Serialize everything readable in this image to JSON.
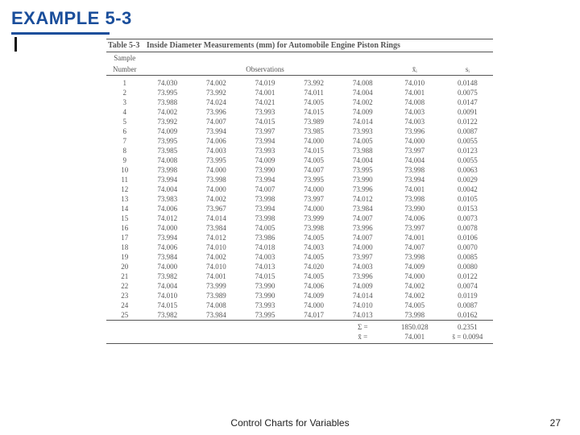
{
  "title": "EXAMPLE 5-3",
  "footer": "Control Charts for Variables",
  "page_number": "27",
  "table": {
    "number": "Table 5-3",
    "title": "Inside Diameter Measurements (mm) for Automobile Engine Piston Rings",
    "headers": {
      "sample1": "Sample",
      "sample2": "Number",
      "observations": "Observations",
      "xbar": "x̄ᵢ",
      "si": "sᵢ"
    },
    "rows": [
      {
        "n": "1",
        "o": [
          "74.030",
          "74.002",
          "74.019",
          "73.992",
          "74.008"
        ],
        "x": "74.010",
        "s": "0.0148"
      },
      {
        "n": "2",
        "o": [
          "73.995",
          "73.992",
          "74.001",
          "74.011",
          "74.004"
        ],
        "x": "74.001",
        "s": "0.0075"
      },
      {
        "n": "3",
        "o": [
          "73.988",
          "74.024",
          "74.021",
          "74.005",
          "74.002"
        ],
        "x": "74.008",
        "s": "0.0147"
      },
      {
        "n": "4",
        "o": [
          "74.002",
          "73.996",
          "73.993",
          "74.015",
          "74.009"
        ],
        "x": "74.003",
        "s": "0.0091"
      },
      {
        "n": "5",
        "o": [
          "73.992",
          "74.007",
          "74.015",
          "73.989",
          "74.014"
        ],
        "x": "74.003",
        "s": "0.0122"
      },
      {
        "n": "6",
        "o": [
          "74.009",
          "73.994",
          "73.997",
          "73.985",
          "73.993"
        ],
        "x": "73.996",
        "s": "0.0087"
      },
      {
        "n": "7",
        "o": [
          "73.995",
          "74.006",
          "73.994",
          "74.000",
          "74.005"
        ],
        "x": "74.000",
        "s": "0.0055"
      },
      {
        "n": "8",
        "o": [
          "73.985",
          "74.003",
          "73.993",
          "74.015",
          "73.988"
        ],
        "x": "73.997",
        "s": "0.0123"
      },
      {
        "n": "9",
        "o": [
          "74.008",
          "73.995",
          "74.009",
          "74.005",
          "74.004"
        ],
        "x": "74.004",
        "s": "0.0055"
      },
      {
        "n": "10",
        "o": [
          "73.998",
          "74.000",
          "73.990",
          "74.007",
          "73.995"
        ],
        "x": "73.998",
        "s": "0.0063"
      },
      {
        "n": "11",
        "o": [
          "73.994",
          "73.998",
          "73.994",
          "73.995",
          "73.990"
        ],
        "x": "73.994",
        "s": "0.0029"
      },
      {
        "n": "12",
        "o": [
          "74.004",
          "74.000",
          "74.007",
          "74.000",
          "73.996"
        ],
        "x": "74.001",
        "s": "0.0042"
      },
      {
        "n": "13",
        "o": [
          "73.983",
          "74.002",
          "73.998",
          "73.997",
          "74.012"
        ],
        "x": "73.998",
        "s": "0.0105"
      },
      {
        "n": "14",
        "o": [
          "74.006",
          "73.967",
          "73.994",
          "74.000",
          "73.984"
        ],
        "x": "73.990",
        "s": "0.0153"
      },
      {
        "n": "15",
        "o": [
          "74.012",
          "74.014",
          "73.998",
          "73.999",
          "74.007"
        ],
        "x": "74.006",
        "s": "0.0073"
      },
      {
        "n": "16",
        "o": [
          "74.000",
          "73.984",
          "74.005",
          "73.998",
          "73.996"
        ],
        "x": "73.997",
        "s": "0.0078"
      },
      {
        "n": "17",
        "o": [
          "73.994",
          "74.012",
          "73.986",
          "74.005",
          "74.007"
        ],
        "x": "74.001",
        "s": "0.0106"
      },
      {
        "n": "18",
        "o": [
          "74.006",
          "74.010",
          "74.018",
          "74.003",
          "74.000"
        ],
        "x": "74.007",
        "s": "0.0070"
      },
      {
        "n": "19",
        "o": [
          "73.984",
          "74.002",
          "74.003",
          "74.005",
          "73.997"
        ],
        "x": "73.998",
        "s": "0.0085"
      },
      {
        "n": "20",
        "o": [
          "74.000",
          "74.010",
          "74.013",
          "74.020",
          "74.003"
        ],
        "x": "74.009",
        "s": "0.0080"
      },
      {
        "n": "21",
        "o": [
          "73.982",
          "74.001",
          "74.015",
          "74.005",
          "73.996"
        ],
        "x": "74.000",
        "s": "0.0122"
      },
      {
        "n": "22",
        "o": [
          "74.004",
          "73.999",
          "73.990",
          "74.006",
          "74.009"
        ],
        "x": "74.002",
        "s": "0.0074"
      },
      {
        "n": "23",
        "o": [
          "74.010",
          "73.989",
          "73.990",
          "74.009",
          "74.014"
        ],
        "x": "74.002",
        "s": "0.0119"
      },
      {
        "n": "24",
        "o": [
          "74.015",
          "74.008",
          "73.993",
          "74.000",
          "74.010"
        ],
        "x": "74.005",
        "s": "0.0087"
      },
      {
        "n": "25",
        "o": [
          "73.982",
          "73.984",
          "73.995",
          "74.017",
          "74.013"
        ],
        "x": "73.998",
        "s": "0.0162"
      }
    ],
    "summary": {
      "sigma_label": "Σ =",
      "sigma_xbar": "1850.028",
      "sigma_si": "0.2351",
      "xbarbar_label": "x̄̄ =",
      "xbarbar": "74.001",
      "sbar": "s̄ = 0.0094"
    }
  }
}
